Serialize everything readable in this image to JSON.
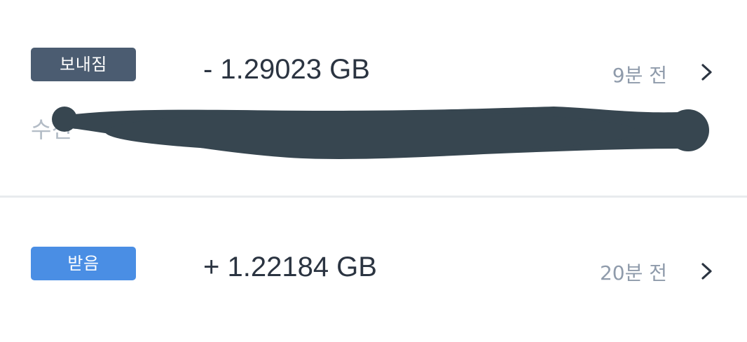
{
  "transactions": [
    {
      "type_label": "보내짐",
      "amount": "- 1.29023 GB",
      "time": "9분 전",
      "sub_label": "수신",
      "badge_color": "#4b5c71",
      "icon": "chevron-right-icon"
    },
    {
      "type_label": "받음",
      "amount": "+ 1.22184 GB",
      "time": "20분 전",
      "badge_color": "#4a8ee4",
      "icon": "chevron-right-icon"
    }
  ],
  "colors": {
    "amount_text": "#2b3441",
    "time_text": "#8f9bab",
    "redaction": "#374650",
    "divider": "#e8ebee"
  }
}
